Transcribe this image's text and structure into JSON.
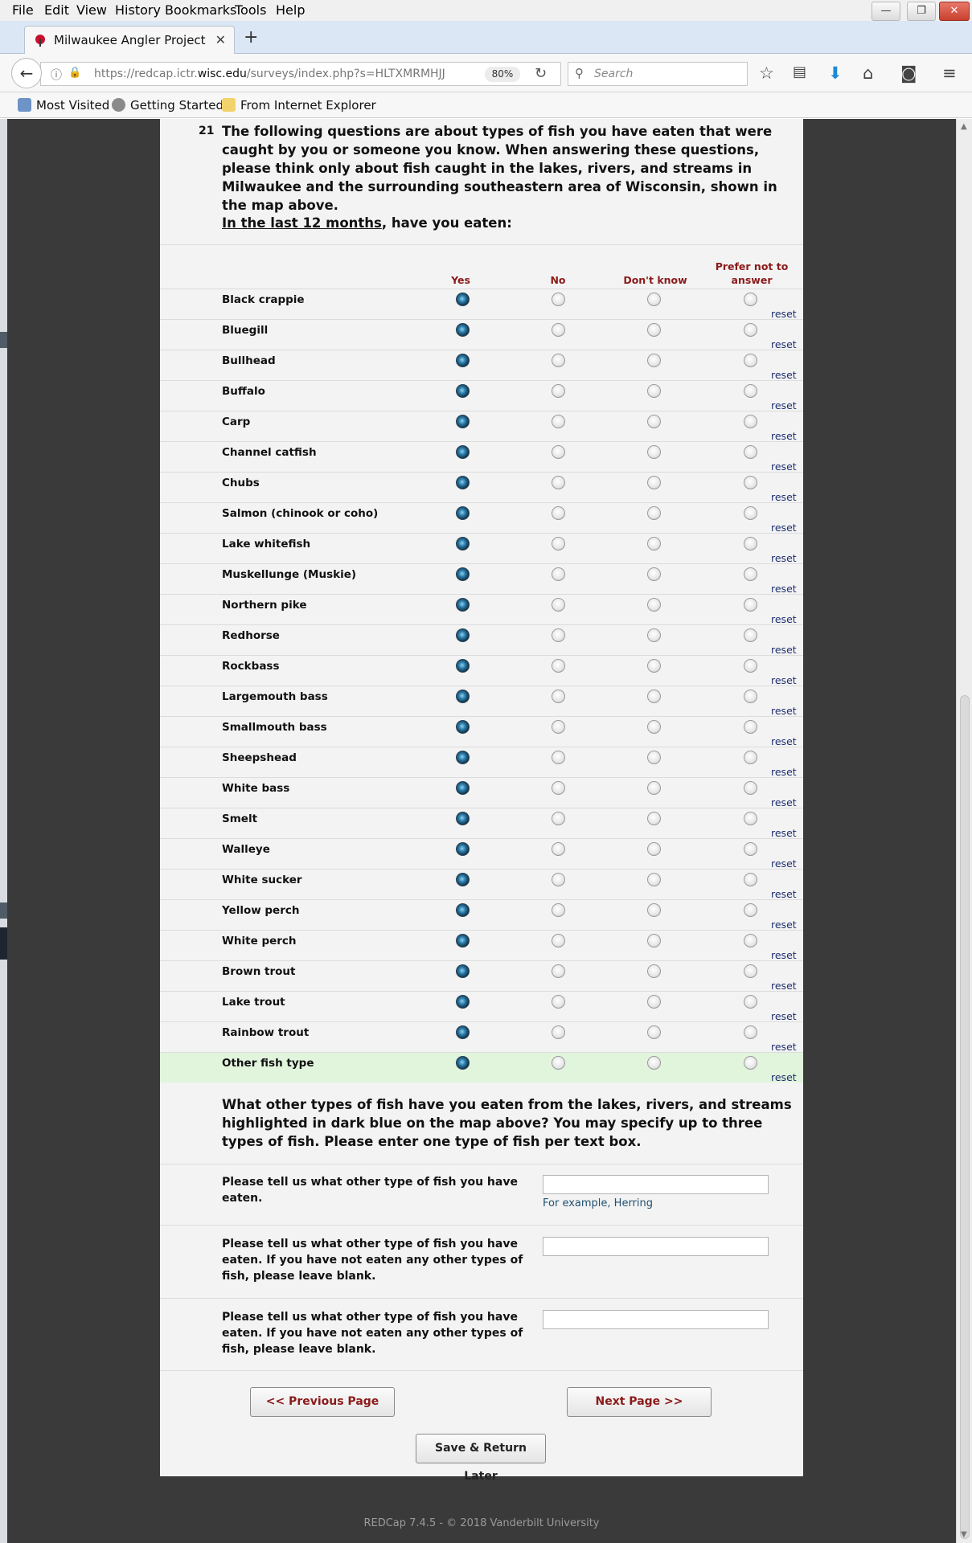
{
  "menu": [
    "File",
    "Edit",
    "View",
    "History",
    "Bookmarks",
    "Tools",
    "Help"
  ],
  "window_controls": {
    "minimize": "—",
    "restore": "❐",
    "close": "✕"
  },
  "tab": {
    "title": "Milwaukee Angler Project",
    "close": "✕",
    "new_tab": "+"
  },
  "nav": {
    "url_prefix": "https://redcap.ictr.",
    "url_domain": "wisc.edu",
    "url_path": "/surveys/index.php?s=HLTXMRMHJJ",
    "zoom": "80%",
    "search_placeholder": "Search"
  },
  "bookmarks": [
    "Most Visited",
    "Getting Started",
    "From Internet Explorer"
  ],
  "question": {
    "number": "21",
    "text": "The following questions are about types of fish you have eaten that were caught by you or someone you know. When answering these questions, please think only about fish caught in the lakes, rivers, and streams in Milwaukee and the surrounding southeastern area of Wisconsin, shown in the map above.",
    "sub_underlined": "In the last 12 months",
    "sub_rest": ", have you eaten:"
  },
  "columns": [
    "Yes",
    "No",
    "Don't know",
    "Prefer not to answer"
  ],
  "reset_label": "reset",
  "fish": [
    "Black crappie",
    "Bluegill",
    "Bullhead",
    "Buffalo",
    "Carp",
    "Channel catfish",
    "Chubs",
    "Salmon (chinook or coho)",
    "Lake whitefish",
    "Muskellunge (Muskie)",
    "Northern pike",
    "Redhorse",
    "Rockbass",
    "Largemouth bass",
    "Smallmouth bass",
    "Sheepshead",
    "White bass",
    "Smelt",
    "Walleye",
    "White sucker",
    "Yellow perch",
    "White perch",
    "Brown trout",
    "Lake trout",
    "Rainbow trout",
    "Other fish type"
  ],
  "selected_answer": "Yes",
  "other_question": "What other types of fish have you eaten from the lakes, rivers, and streams highlighted in dark blue on the map above? You may specify up to three types of fish. Please enter one type of fish per text box.",
  "text_inputs": [
    {
      "label": "Please tell us what other type of fish you have eaten.",
      "value": "",
      "hint": "For example, Herring"
    },
    {
      "label": "Please tell us what other type of fish you have eaten. If you have not eaten any other types of fish, please leave blank.",
      "value": ""
    },
    {
      "label": "Please tell us what other type of fish you have eaten. If you have not eaten any other types of fish, please leave blank.",
      "value": ""
    }
  ],
  "buttons": {
    "previous": "<< Previous Page",
    "next": "Next Page >>",
    "save": "Save & Return Later"
  },
  "footer": "REDCap 7.4.5 - © 2018 Vanderbilt University"
}
